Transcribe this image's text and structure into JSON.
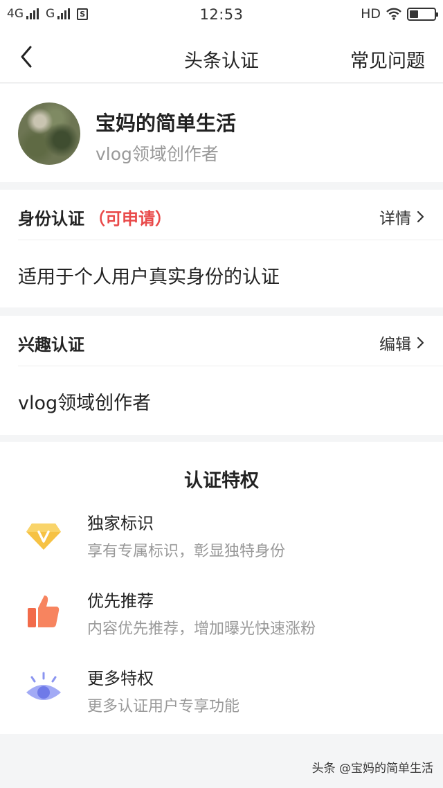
{
  "status_bar": {
    "network_left": "4G",
    "network_right": "G",
    "time": "12:53",
    "hd": "HD",
    "sim_label": "S",
    "battery_level": 0.35
  },
  "nav": {
    "title": "头条认证",
    "faq": "常见问题"
  },
  "profile": {
    "name": "宝妈的简单生活",
    "subtitle": "vlog领域创作者"
  },
  "identity": {
    "title": "身份认证",
    "tag": "（可申请）",
    "action": "详情",
    "body": "适用于个人用户真实身份的认证"
  },
  "interest": {
    "title": "兴趣认证",
    "action": "编辑",
    "body": "vlog领域创作者"
  },
  "privileges": {
    "title": "认证特权",
    "items": [
      {
        "icon": "diamond-v-icon",
        "name": "独家标识",
        "desc": "享有专属标识，彰显独特身份"
      },
      {
        "icon": "thumbs-up-icon",
        "name": "优先推荐",
        "desc": "内容优先推荐，增加曝光快速涨粉"
      },
      {
        "icon": "eye-icon",
        "name": "更多特权",
        "desc": "更多认证用户专享功能"
      }
    ]
  },
  "colors": {
    "accent_red": "#e94a4a",
    "diamond_gold": "#f6c244",
    "thumb_orange": "#f26b4a",
    "eye_blue": "#8b95f0"
  },
  "watermark": "头条 @宝妈的简单生活"
}
